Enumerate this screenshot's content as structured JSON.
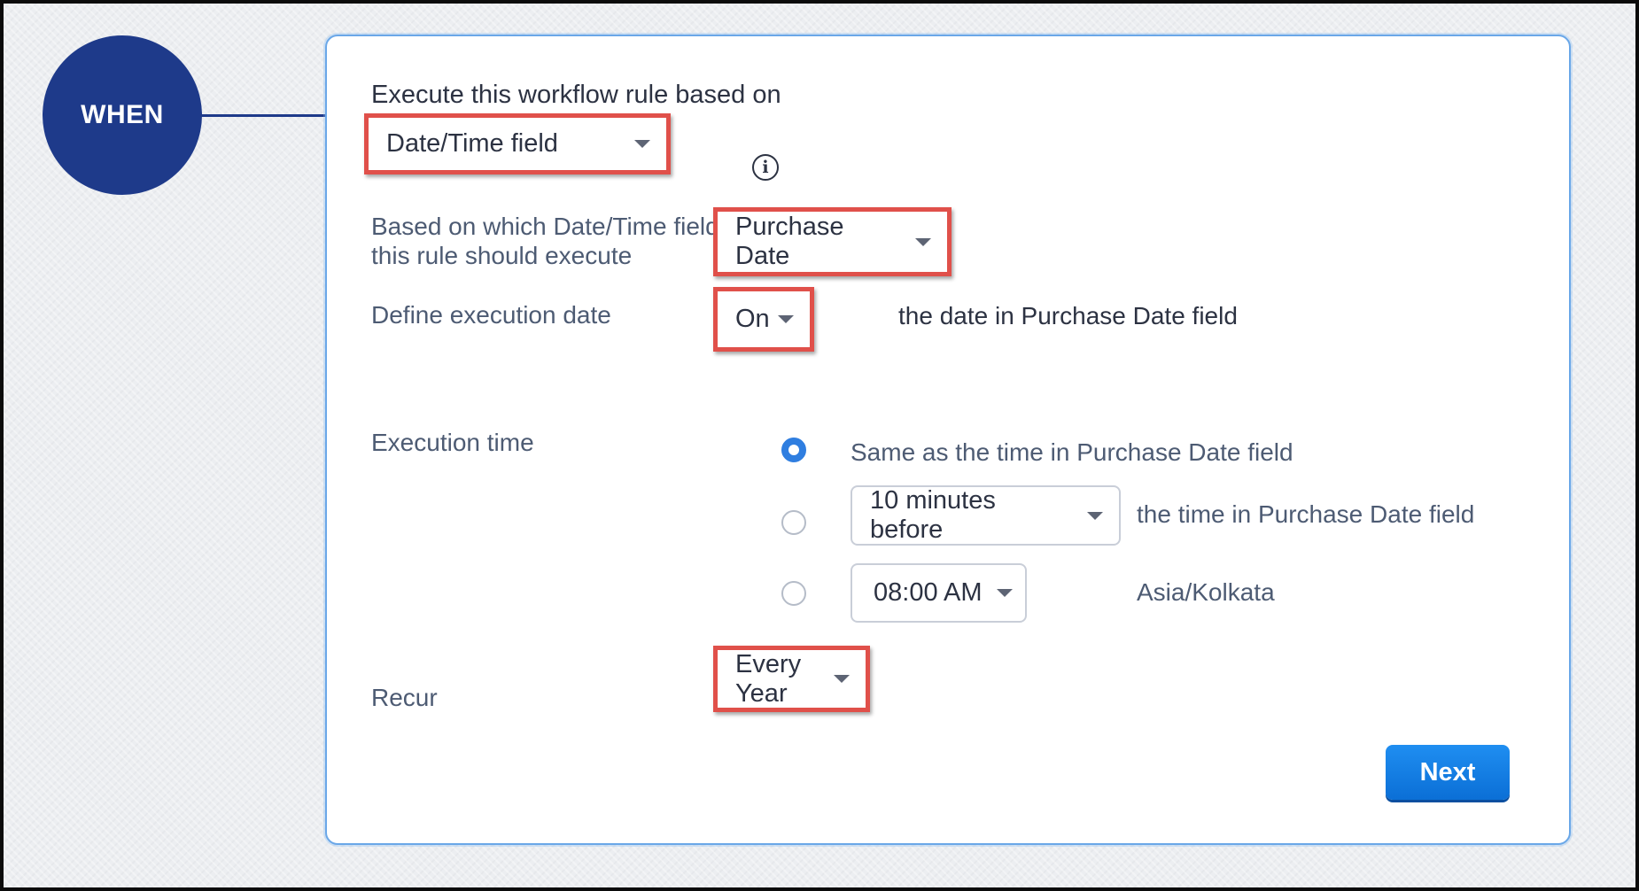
{
  "when": {
    "label": "WHEN"
  },
  "form": {
    "heading": "Execute this workflow rule based on",
    "trigger_select": {
      "value": "Date/Time field"
    },
    "info_icon": "info-icon",
    "date_field": {
      "label_line1": "Based on which Date/Time field",
      "label_line2": "this rule should execute",
      "value": "Purchase Date"
    },
    "execution_date": {
      "label": "Define execution date",
      "value": "On",
      "suffix": "the date in Purchase Date field"
    },
    "execution_time": {
      "label": "Execution time",
      "options": [
        {
          "text": "Same as the time in Purchase Date field",
          "checked": true
        },
        {
          "select": "10 minutes before",
          "suffix": "the time in Purchase Date field",
          "checked": false
        },
        {
          "select": "08:00 AM",
          "suffix": "Asia/Kolkata",
          "checked": false
        }
      ]
    },
    "recur": {
      "label": "Recur",
      "value": "Every Year"
    },
    "next_label": "Next"
  },
  "colors": {
    "when_circle": "#1e3a8a",
    "highlight_border": "#e0504a",
    "radio_checked": "#2f7ee0",
    "next_button": "#0b6fd6",
    "card_border": "#6aa7e8"
  }
}
